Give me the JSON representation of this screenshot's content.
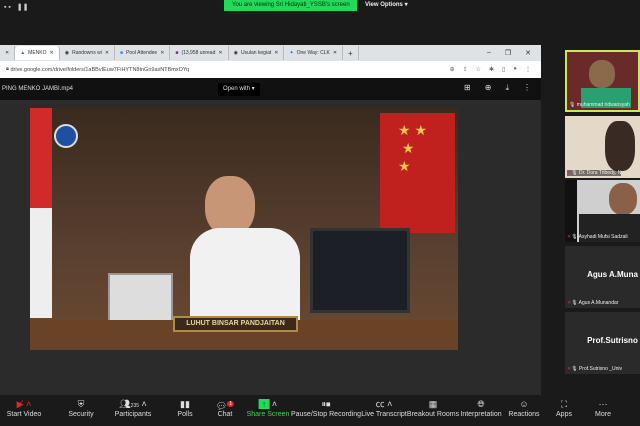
{
  "banner": {
    "text": "You are viewing Sri Hidayati_YSSB's screen",
    "view_options": "View Options"
  },
  "browser": {
    "tabs": [
      "MENKO",
      "Randowns wi",
      "Pool Attendee",
      "(13,958 unread",
      "Usulan kegiat",
      "One Way: CLK"
    ],
    "url": "drive.google.com/drive/folders/1aBBvIEuw7FiHYTN8tnGn9axNTBmxOYq",
    "file_name": "PING MENKO JAMBI.mp4",
    "open_with": "Open with"
  },
  "video": {
    "nameplate": "LUHUT BINSAR PANDJAITAN"
  },
  "participants": [
    {
      "name": "muhammad ridwansyah",
      "active": true
    },
    {
      "name": "Dr. Dora Tribedy, N"
    },
    {
      "name": "Asyhadi Mufsi Sadzali"
    },
    {
      "name": "Agus A.Munandar",
      "display": "Agus A.Muna"
    },
    {
      "name": "Prof.Sutrisno _Univ",
      "display": "Prof.Sutrisno"
    }
  ],
  "toolbar": {
    "start_video": "Start Video",
    "security": "Security",
    "participants": "Participants",
    "participant_count": "235",
    "polls": "Polls",
    "chat": "Chat",
    "chat_badge": "1",
    "share_screen": "Share Screen",
    "recording": "Pause/Stop Recording",
    "live_transcript": "Live Transcript",
    "breakout": "Breakout Rooms",
    "interpretation": "Interpretation",
    "reactions": "Reactions",
    "apps": "Apps",
    "more": "More"
  },
  "colors": {
    "share_green": "#23d959",
    "active_border": "#c9e85a",
    "danger": "#e02828"
  }
}
